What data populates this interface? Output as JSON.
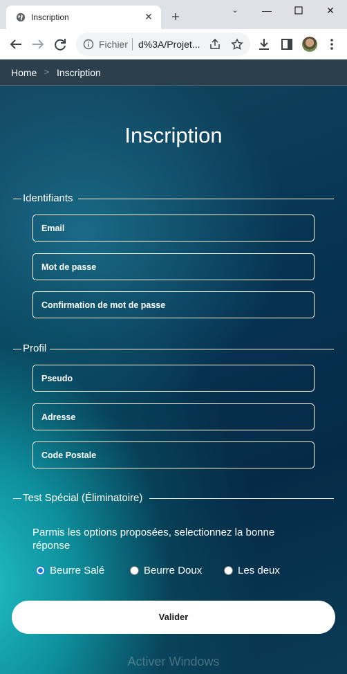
{
  "browser": {
    "tab_title": "Inscription",
    "new_tab_label": "+",
    "omnibox_scheme": "Fichier",
    "omnibox_url": "d%3A/Projet..."
  },
  "breadcrumb": {
    "home": "Home",
    "separator": ">",
    "current": "Inscription"
  },
  "page_title": "Inscription",
  "sections": {
    "identifiants": {
      "legend": "Identifiants",
      "fields": [
        "Email",
        "Mot de passe",
        "Confirmation de mot de passe"
      ]
    },
    "profil": {
      "legend": "Profil",
      "fields": [
        "Pseudo",
        "Adresse",
        "Code Postale"
      ]
    },
    "test": {
      "legend": "Test Spécial (Éliminatoire)",
      "question": "Parmis les options proposées, selectionnez la bonne réponse",
      "options": [
        "Beurre Salé",
        "Beurre Doux",
        "Les deux"
      ],
      "selected_option": "Beurre Salé"
    }
  },
  "submit_label": "Valider",
  "watermark": "Activer Windows",
  "colors": {
    "accent_radio": "#1a73e8",
    "breadcrumb_bg": "#2b3f4d",
    "page_dark": "#052a47",
    "page_teal": "#22c2c6"
  }
}
